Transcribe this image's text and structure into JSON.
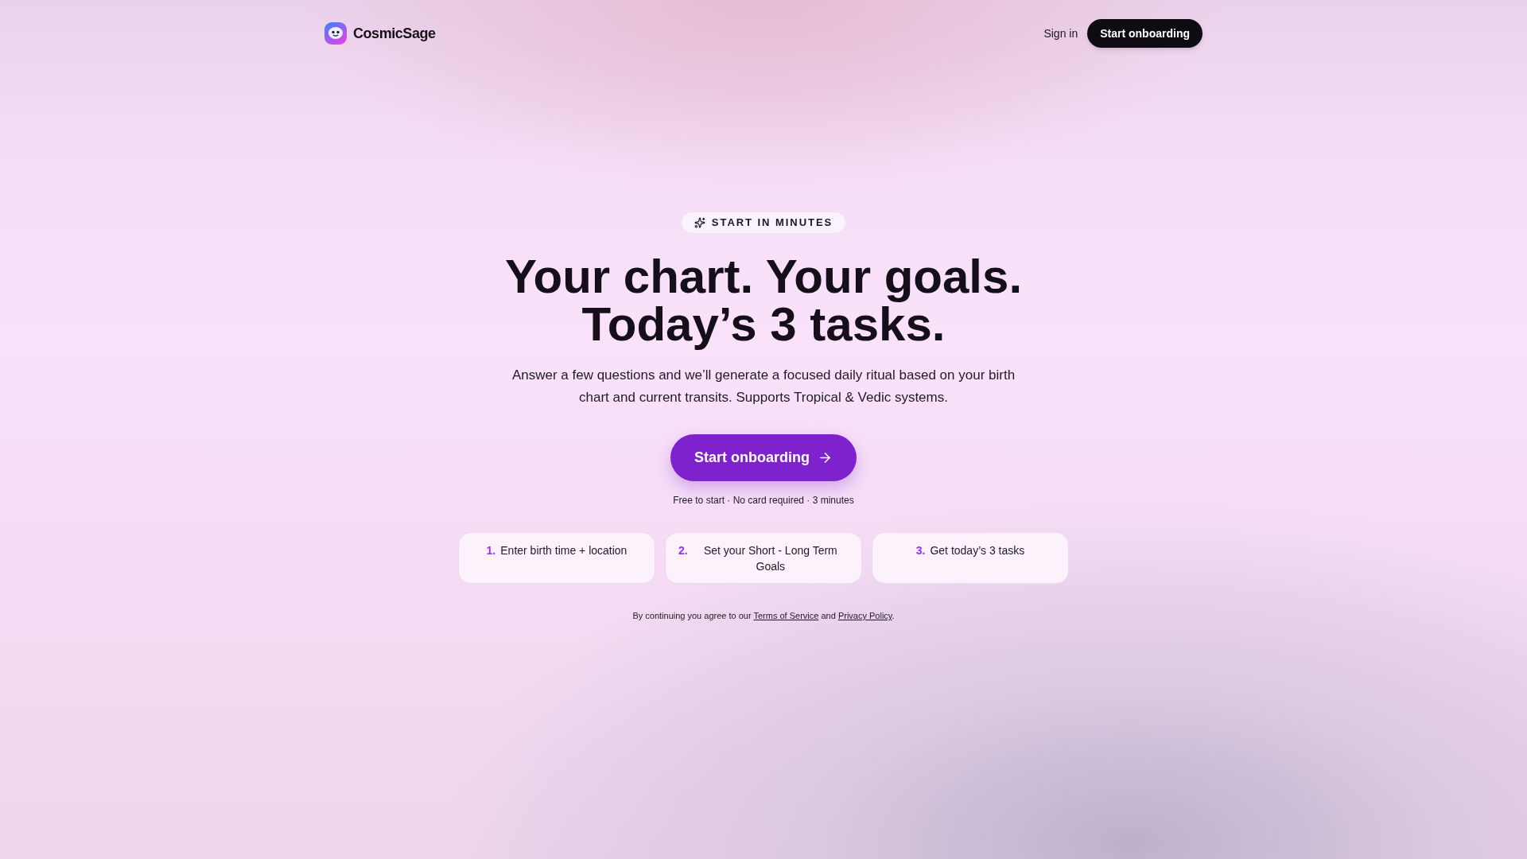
{
  "header": {
    "brand": "CosmicSage",
    "nav": [
      {
        "kind": "link",
        "label": "Sign in"
      },
      {
        "kind": "button",
        "label": "Start onboarding"
      }
    ]
  },
  "hero": {
    "badge": "START IN MINUTES",
    "headline_lines": [
      "Your chart. Your goals.",
      "Today’s 3 tasks."
    ],
    "description": "Answer a few questions and we’ll generate a focused daily ritual based on your birth chart and current transits. Supports Tropical & Vedic systems.",
    "cta": "Start onboarding",
    "note": "Free to start · No card required · 3 minutes"
  },
  "steps": [
    {
      "number": "1.",
      "text": "Enter birth time + location"
    },
    {
      "number": "2.",
      "text": "Set your Short - Long Term Goals"
    },
    {
      "number": "3.",
      "text": "Get today’s 3 tasks"
    }
  ],
  "consent": {
    "parts": [
      {
        "kind": "text",
        "text": "By continuing you agree to our "
      },
      {
        "kind": "link",
        "text": "Terms of Service"
      },
      {
        "kind": "text",
        "text": " and "
      },
      {
        "kind": "link",
        "text": "Privacy Policy"
      },
      {
        "kind": "text",
        "text": "."
      }
    ]
  }
}
